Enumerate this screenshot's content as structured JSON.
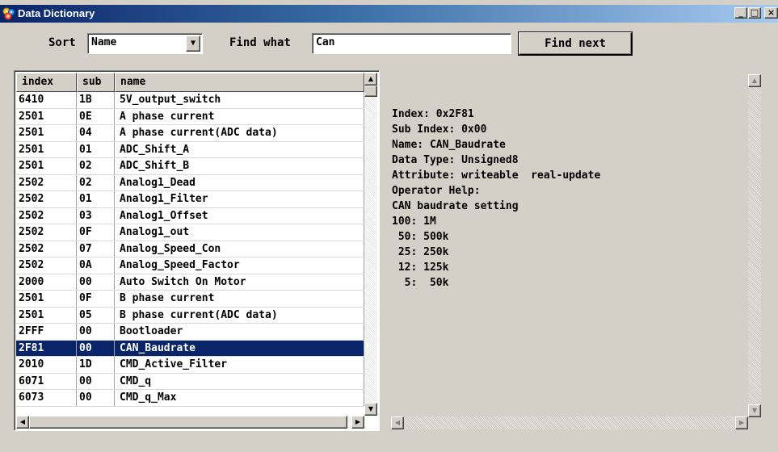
{
  "window": {
    "title": "Data Dictionary",
    "app_icon": "gear-cluster-icon",
    "controls": {
      "minimize": "_",
      "maximize": "□",
      "close": "×"
    }
  },
  "toolbar": {
    "sort_label": "Sort",
    "sort_value": "Name",
    "find_label": "Find what",
    "find_value": "Can",
    "find_next_label": "Find next"
  },
  "list": {
    "columns": [
      "index",
      "sub",
      "name"
    ],
    "rows": [
      {
        "index": "6410",
        "sub": "1B",
        "name": "5V_output_switch"
      },
      {
        "index": "2501",
        "sub": "0E",
        "name": "A phase current"
      },
      {
        "index": "2501",
        "sub": "04",
        "name": "A phase current(ADC data)"
      },
      {
        "index": "2501",
        "sub": "01",
        "name": "ADC_Shift_A"
      },
      {
        "index": "2501",
        "sub": "02",
        "name": "ADC_Shift_B"
      },
      {
        "index": "2502",
        "sub": "02",
        "name": "Analog1_Dead"
      },
      {
        "index": "2502",
        "sub": "01",
        "name": "Analog1_Filter"
      },
      {
        "index": "2502",
        "sub": "03",
        "name": "Analog1_Offset"
      },
      {
        "index": "2502",
        "sub": "0F",
        "name": "Analog1_out"
      },
      {
        "index": "2502",
        "sub": "07",
        "name": "Analog_Speed_Con"
      },
      {
        "index": "2502",
        "sub": "0A",
        "name": "Analog_Speed_Factor"
      },
      {
        "index": "2000",
        "sub": "00",
        "name": "Auto Switch On Motor"
      },
      {
        "index": "2501",
        "sub": "0F",
        "name": "B phase current"
      },
      {
        "index": "2501",
        "sub": "05",
        "name": "B phase current(ADC data)"
      },
      {
        "index": "2FFF",
        "sub": "00",
        "name": "Bootloader"
      },
      {
        "index": "2F81",
        "sub": "00",
        "name": "CAN_Baudrate"
      },
      {
        "index": "2010",
        "sub": "1D",
        "name": "CMD_Active_Filter"
      },
      {
        "index": "6071",
        "sub": "00",
        "name": "CMD_q"
      },
      {
        "index": "6073",
        "sub": "00",
        "name": "CMD_q_Max"
      }
    ],
    "selected_index": 15
  },
  "detail": {
    "lines": [
      "Index: 0x2F81",
      "Sub Index: 0x00",
      "Name: CAN_Baudrate",
      "Data Type: Unsigned8",
      "Attribute: writeable  real-update",
      "Operator Help:",
      "CAN baudrate setting",
      "100: 1M",
      " 50: 500k",
      " 25: 250k",
      " 12: 125k",
      "  5:  50k"
    ]
  },
  "colors": {
    "selection": "#0a246a",
    "dialog_bg": "#d4d0c8"
  }
}
